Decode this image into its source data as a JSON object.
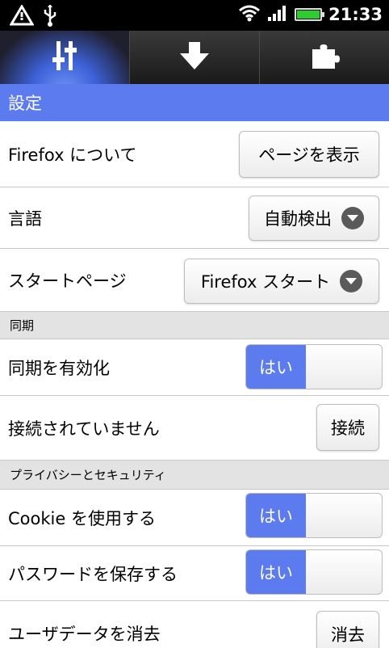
{
  "statusbar": {
    "time": "21:33"
  },
  "tabs": [
    {
      "icon": "settings-sliders-icon",
      "active": true
    },
    {
      "icon": "download-arrow-icon",
      "active": false
    },
    {
      "icon": "addon-puzzle-icon",
      "active": false
    }
  ],
  "page_title": "設定",
  "rows": {
    "about_label": "Firefox について",
    "about_button": "ページを表示",
    "language_label": "言語",
    "language_value": "自動検出",
    "startpage_label": "スタートページ",
    "startpage_value": "Firefox スタート",
    "sync_section": "同期",
    "sync_enable_label": "同期を有効化",
    "sync_enable_value": "はい",
    "sync_status_label": "接続されていません",
    "sync_connect_button": "接続",
    "privacy_section": "プライバシーとセキュリティ",
    "cookie_label": "Cookie を使用する",
    "cookie_value": "はい",
    "password_label": "パスワードを保存する",
    "password_value": "はい",
    "clear_label": "ユーザデータを消去",
    "clear_button": "消去"
  },
  "colors": {
    "accent": "#5c7bee",
    "section_bg": "#e3e3e3"
  }
}
